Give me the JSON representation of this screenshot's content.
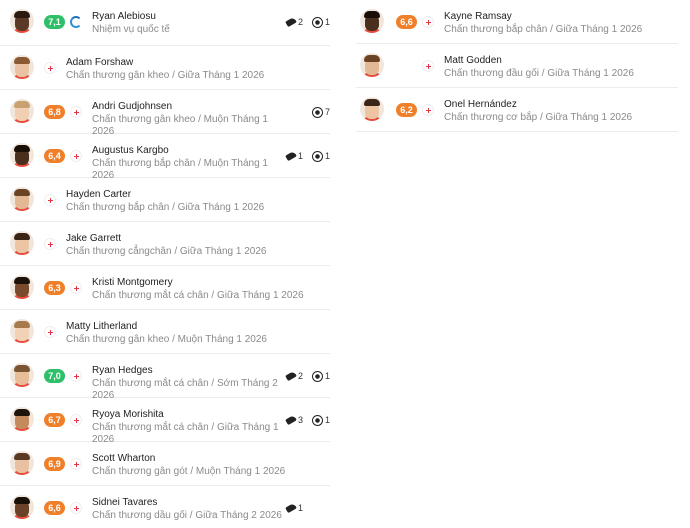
{
  "left_players": [
    {
      "name": "Ryan Alebiosu",
      "reason": "Nhiệm vụ quốc tế",
      "rating": "7,1",
      "rating_color": "green",
      "status": "international",
      "assists": "2",
      "goals": "1"
    },
    {
      "name": "Adam Forshaw",
      "reason": "Chấn thương gân kheo / Giữa Tháng 1 2026",
      "rating": "",
      "rating_color": "",
      "status": "injury",
      "assists": "",
      "goals": ""
    },
    {
      "name": "Andri Gudjohnsen",
      "reason": "Chấn thương gân kheo / Muộn Tháng 1 2026",
      "rating": "6,8",
      "rating_color": "orange",
      "status": "injury",
      "assists": "",
      "goals": "7"
    },
    {
      "name": "Augustus Kargbo",
      "reason": "Chấn thương bắp chân / Muộn Tháng 1 2026",
      "rating": "6,4",
      "rating_color": "orange",
      "status": "injury",
      "assists": "1",
      "goals": "1"
    },
    {
      "name": "Hayden Carter",
      "reason": "Chấn thương bắp chân / Giữa Tháng 1 2026",
      "rating": "",
      "rating_color": "",
      "status": "injury",
      "assists": "",
      "goals": ""
    },
    {
      "name": "Jake Garrett",
      "reason": "Chấn thương cẳngchân / Giữa Tháng 1 2026",
      "rating": "",
      "rating_color": "",
      "status": "injury",
      "assists": "",
      "goals": ""
    },
    {
      "name": "Kristi Montgomery",
      "reason": "Chấn thương mắt cá chân / Giữa Tháng 1 2026",
      "rating": "6,3",
      "rating_color": "orange",
      "status": "injury",
      "assists": "",
      "goals": ""
    },
    {
      "name": "Matty Litherland",
      "reason": "Chấn thương gân kheo / Muộn Tháng 1 2026",
      "rating": "",
      "rating_color": "",
      "status": "injury",
      "assists": "",
      "goals": ""
    },
    {
      "name": "Ryan Hedges",
      "reason": "Chấn thương mắt cá chân / Sớm Tháng 2 2026",
      "rating": "7,0",
      "rating_color": "green",
      "status": "injury",
      "assists": "2",
      "goals": "1"
    },
    {
      "name": "Ryoya Morishita",
      "reason": "Chấn thương mắt cá chân / Giữa Tháng 1 2026",
      "rating": "6,7",
      "rating_color": "orange",
      "status": "injury",
      "assists": "3",
      "goals": "1"
    },
    {
      "name": "Scott Wharton",
      "reason": "Chấn thương gân gót / Muộn Tháng 1 2026",
      "rating": "6,9",
      "rating_color": "orange",
      "status": "injury",
      "assists": "",
      "goals": ""
    },
    {
      "name": "Sidnei Tavares",
      "reason": "Chấn thương dầu gối / Giữa Tháng 2 2026",
      "rating": "6,6",
      "rating_color": "orange",
      "status": "injury",
      "assists": "1",
      "goals": ""
    }
  ],
  "right_players": [
    {
      "name": "Kayne Ramsay",
      "reason": "Chấn thương bắp chân / Giữa Tháng 1 2026",
      "rating": "6,6",
      "rating_color": "orange",
      "status": "injury"
    },
    {
      "name": "Matt Godden",
      "reason": "Chấn thương đầu gối / Giữa Tháng 1 2026",
      "rating": "",
      "rating_color": "",
      "status": "injury"
    },
    {
      "name": "Onel Hernández",
      "reason": "Chấn thương cơ bắp / Giữa Tháng 1 2026",
      "rating": "6,2",
      "rating_color": "orange",
      "status": "injury"
    }
  ],
  "icons": {
    "assist": "boot-icon",
    "goal": "football-icon",
    "injury": "injury-cross-icon",
    "international": "international-duty-icon"
  },
  "colors": {
    "rating_green": "#2ec069",
    "rating_orange": "#f07f2a",
    "injury": "#e4344a",
    "international": "#2f8fd8"
  }
}
